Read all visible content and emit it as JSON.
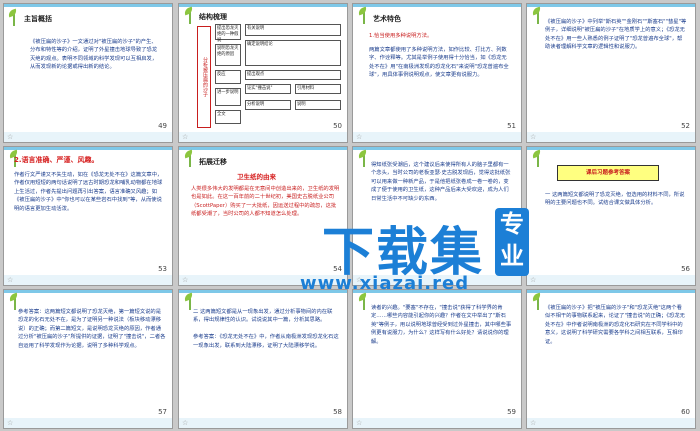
{
  "slides": [
    {
      "num": "49",
      "title": "主旨概括",
      "body": "《被压扁的沙子》一文通过对\"被压扁的沙子\"的产生、分布和特性等的介绍，证明了外星撞击地球导致了恐龙灭绝的观点。表明不同领域的科学发现可以互相启发，从而发现新的论据或得出新的结论。"
    },
    {
      "num": "50",
      "title": "结构梳理",
      "diagram": {
        "side": "分析被压扁的沙子",
        "boxes": [
          "提出恐龙灭绝的一种假说",
          "有关说明",
          "说明恐龙灭绝的原因",
          "确定说明结论",
          "反应",
          "提出观点",
          "进一步说明",
          "证实\"撞击说\"",
          "引用材料",
          "全文",
          "分析说明",
          "说明"
        ]
      }
    },
    {
      "num": "51",
      "title": "艺术特色",
      "sub": "1.恰当使用多种说明方法。",
      "body": "两篇文章都使用了多种说明方法，如作比较、打比方、列数字、作诠释等。尤其是举例子使用得十分恰当，如《恐龙无处不在》用\"在南极洲发现的恐龙化石\"来说明\"恐龙曾遍布全球\"，用具体事例说明观点，使文章更有说服力。"
    },
    {
      "num": "52",
      "title": "",
      "body": "《被压扁的沙子》中列举\"斯石英\"\"金刚石\"\"斯塞石\"\"彗星\"等例子，详细说明\"被压扁的沙子\"在地质学上的意义；《恐龙无处不在》用一些人熟悉的例子证明了\"恐龙曾遍布全球\"，帮助读者理解科学文章的逻辑性和说服力。"
    },
    {
      "num": "53",
      "title": "2.语言准确、严谨、风趣。",
      "body": "作者行文严谨又不失生动，如在《恐龙无处不在》这篇文章中，作者仅用短短的两句话说明了远古时期恐龙和哺乳动物都在地球上生活过，作者先提出问题再引出答案，语言准确又风趣；如《被压扁的沙子》中\"你也可以在某些岩石中找到\"等，从而使说明的语言更加生动活泼。"
    },
    {
      "num": "54",
      "title": "拓展迁移",
      "sub": "卫生纸的由来",
      "body": "人类很多伟大的发明都是在无意间中创造出来的，卫生纸的发明也是如此。在这一百年前的二十世纪初，美国史古脱纸业公司（ScottPaper）购买了一大批纸，因运送过程中的疏忽，这批纸都受潮了，当时公司的人都不知道怎么处理。"
    },
    {
      "num": "55",
      "title": "",
      "body": "得知纸张受潮后，这个建议后来使得所有人的脑子里都有一个念头，当时公司的老板亚瑟·史古脱发现后，觉得这批纸张可以用来做一种新产品，于是他把纸张卷成一卷一卷的，变成了便于使用的卫生纸，这种产品后来大受欢迎，成为人们日常生活中不可缺少的东西。"
    },
    {
      "num": "56",
      "title": "",
      "button": "课后习题参考答案",
      "body": "一  这两篇短文都说明了恐龙灭绝，但选用的材料不同，所说明的主要问题也不同。试结合课文做具体分析。"
    },
    {
      "num": "57",
      "title": "",
      "body": "参考答案：这两篇短文都说明了恐龙灭绝，第一篇短文说的是恐龙的化石无处不在，是为了证明另一种说法（板块移动漂移说）的正确；而第二篇短文，是说明恐龙灭绝的原因，作者通过分析\"被压扁的沙子\"所提供的证据，证明了\"撞击说\"，二者各自运用了科学发现作为论据，说明了多种科学观点。"
    },
    {
      "num": "58",
      "title": "",
      "body": "二  这两篇短文都是从一现象出发，通过分析事物间的内在联系，得出规律性的认识。试说说其中一篇，分析其思路。\n\n参考答案：《恐龙无处不在》中，作者从南极洲发现恐龙化石这一现象出发，联系到大陆漂移，证明了大陆漂移学说。"
    },
    {
      "num": "59",
      "title": "",
      "body": "读者的兴趣。\"要塞\"不存在，\"撞击说\"获得了科学界的肯定……哪些内容能引起你的兴趣？作者在文中举出了\"斯石英\"等例子，用以说明地球曾经受到过外星撞击，其中哪些事例更有说服力，为什么？这样写有什么好处？请说说你的理解。"
    },
    {
      "num": "60",
      "title": "",
      "body": "《被压扁的沙子》把\"被压扁的沙子\"和\"恐龙灭绝\"这两个看似不相干的事物联系起来，论证了\"撞击说\"的正确；《恐龙无处不在》中作者说明南极洲的恐龙化石研究在不同学科中的意义，这说明了科学研究需要各学科之间相互联系，互相印证。"
    }
  ],
  "watermark": {
    "main": "下载集",
    "url": "www.xiazai.red",
    "tag": "专业"
  }
}
